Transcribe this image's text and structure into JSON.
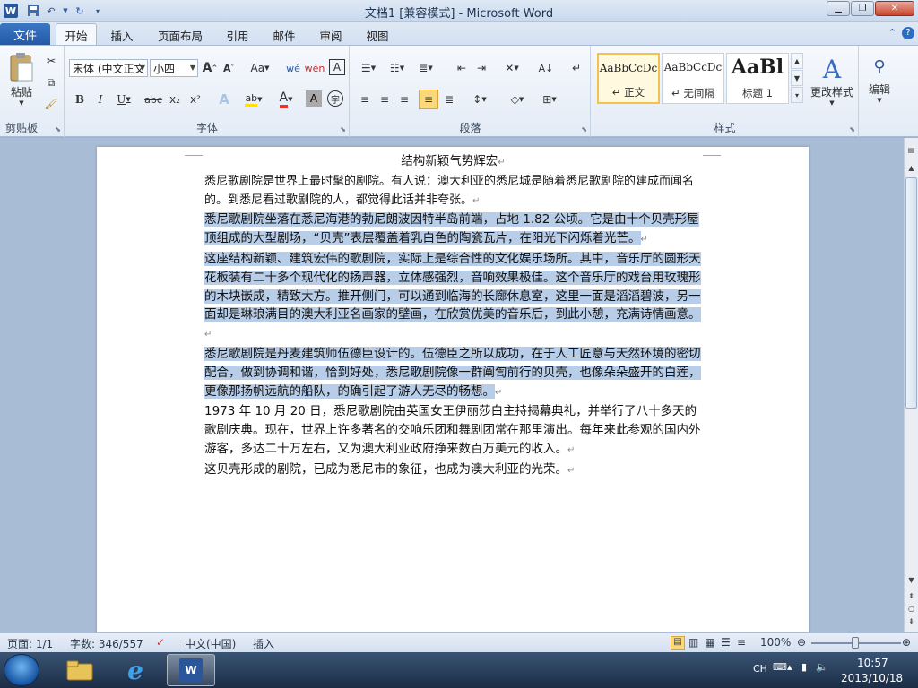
{
  "titlebar": {
    "title": "文档1 [兼容模式] - Microsoft Word",
    "app_icon": "W"
  },
  "qat": {
    "save_icon": "save-icon",
    "undo_icon": "undo-icon",
    "redo_icon": "redo-icon"
  },
  "tabs": {
    "file": "文件",
    "items": [
      "开始",
      "插入",
      "页面布局",
      "引用",
      "邮件",
      "审阅",
      "视图"
    ]
  },
  "clipboard": {
    "paste": "粘贴",
    "group": "剪贴板"
  },
  "font": {
    "name": "宋体 (中文正文",
    "size": "小四",
    "group": "字体",
    "grow": "A",
    "shrink": "A",
    "case": "Aa",
    "bold": "B",
    "italic": "I",
    "underline": "U",
    "strike": "abc",
    "sub": "x₂",
    "sup": "x²"
  },
  "paragraph": {
    "group": "段落"
  },
  "styles": {
    "group": "样式",
    "items": [
      {
        "preview": "AaBbCcDc",
        "name": "↵ 正文"
      },
      {
        "preview": "AaBbCcDc",
        "name": "↵ 无间隔"
      },
      {
        "preview": "AaBl",
        "name": "标题 1"
      }
    ],
    "change": "更改样式"
  },
  "editing": {
    "label": "编辑"
  },
  "document": {
    "title": "结构新颖气势辉宏",
    "p1": "悉尼歌剧院是世界上最时髦的剧院。有人说：澳大利亚的悉尼城是随着悉尼歌剧院的建成而闻名的。到悉尼看过歌剧院的人，都觉得此话并非夸张。",
    "p2": "悉尼歌剧院坐落在悉尼海港的勃尼朗波因特半岛前端，占地 1.82 公顷。它是由十个贝壳形屋顶组成的大型剧场，“贝壳”表层覆盖着乳白色的陶瓷瓦片，在阳光下闪烁着光芒。",
    "p3": "这座结构新颖、建筑宏伟的歌剧院，实际上是综合性的文化娱乐场所。其中，音乐厅的圆形天花板装有二十多个现代化的扬声器，立体感强烈，音响效果极佳。这个音乐厅的戏台用玫瑰形的木块嵌成，精致大方。推开侧门，可以通到临海的长廊休息室，这里一面是滔滔碧波，另一面却是琳琅满目的澳大利亚名画家的壁画，在欣赏优美的音乐后，到此小憩，充满诗情画意。",
    "p4": "悉尼歌剧院是丹麦建筑师伍德臣设计的。伍德臣之所以成功，在于人工匠意与天然环境的密切配合，做到协调和谐，恰到好处，悉尼歌剧院像一群阐訇前行的贝壳，也像朵朵盛开的白莲，更像那扬帆远航的船队，的确引起了游人无尽的畅想。",
    "p5": "1973 年 10 月 20 日，悉尼歌剧院由英国女王伊丽莎白主持揭幕典礼，并举行了八十多天的歌剧庆典。现在，世界上许多著名的交响乐团和舞剧团常在那里演出。每年来此参观的国内外游客，多达二十万左右，又为澳大利亚政府挣来数百万美元的收入。",
    "p6": "这贝壳形成的剧院，已成为悉尼市的象征，也成为澳大利亚的光荣。",
    "mark": "↵"
  },
  "status": {
    "page": "页面: 1/1",
    "words": "字数: 346/557",
    "lang": "中文(中国)",
    "mode": "插入",
    "zoom": "100%"
  },
  "taskbar": {
    "ime": "CH",
    "time": "10:57",
    "date": "2013/10/18"
  }
}
